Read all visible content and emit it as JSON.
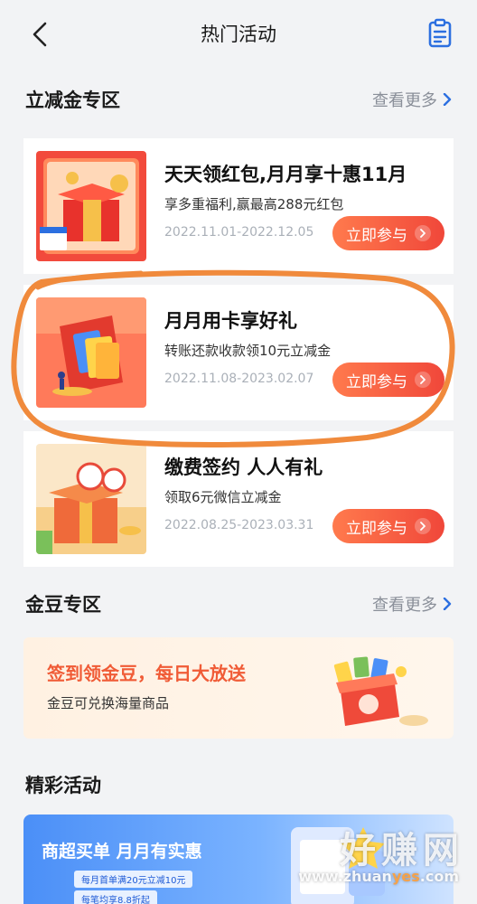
{
  "header": {
    "title": "热门活动"
  },
  "discount_section": {
    "title": "立减金专区",
    "more_label": "查看更多"
  },
  "activities": [
    {
      "title": "天天领红包,月月享十惠11月",
      "desc": "享多重福利,赢最高288元红包",
      "date": "2022.11.01-2022.12.05",
      "button_label": "立即参与"
    },
    {
      "title": "月月用卡享好礼",
      "desc": "转账还款收款领10元立减金",
      "date": "2022.11.08-2023.02.07",
      "button_label": "立即参与"
    },
    {
      "title": "缴费签约 人人有礼",
      "desc": "领取6元微信立减金",
      "date": "2022.08.25-2023.03.31",
      "button_label": "立即参与"
    }
  ],
  "gold_section": {
    "title": "金豆专区",
    "more_label": "查看更多",
    "banner_title": "签到领金豆，每日大放送",
    "banner_sub": "金豆可兑换海量商品"
  },
  "featured_section": {
    "title": "精彩活动",
    "banner_title": "商超买单 月月有实惠",
    "banner_line1": "每月首单满20元立减10元",
    "banner_line2": "每笔均享8.8折起"
  },
  "watermark": {
    "main": "好赚网",
    "sub_pre": "www.zhuan",
    "sub_hl": "yes",
    "sub_post": ".com"
  },
  "colors": {
    "accent": "#f0473a",
    "background": "#f2f3f5",
    "annotation": "#f08a3c"
  }
}
